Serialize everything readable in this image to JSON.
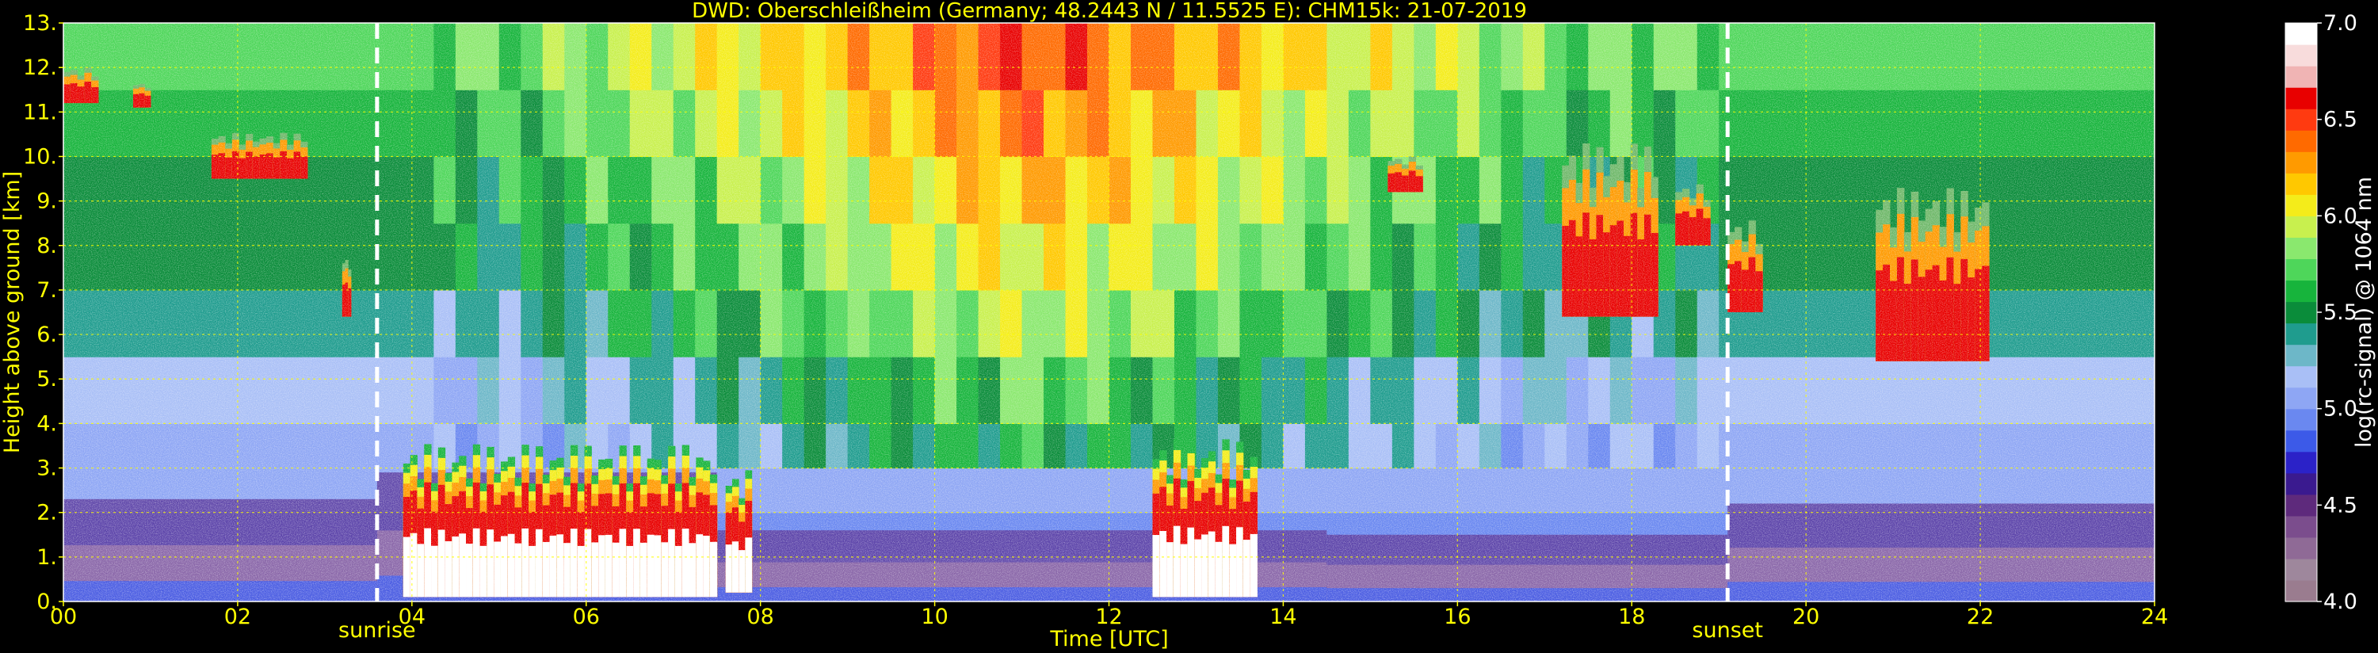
{
  "chart_data": {
    "type": "heatmap",
    "title": "DWD: Oberschleißheim (Germany; 48.2443 N / 11.5525 E):    CHM15k: 21-07-2019",
    "xlabel": "Time [UTC]",
    "ylabel": "Height above ground [km]",
    "xlim": [
      0,
      24
    ],
    "ylim": [
      0,
      13
    ],
    "x_ticks": [
      "00",
      "02",
      "04",
      "06",
      "08",
      "10",
      "12",
      "14",
      "16",
      "18",
      "20",
      "22",
      "24"
    ],
    "y_ticks": [
      "0.",
      "1.",
      "2.",
      "3.",
      "4.",
      "5.",
      "6.",
      "7.",
      "8.",
      "9.",
      "10.",
      "11.",
      "12.",
      "13."
    ],
    "grid": true,
    "colorbar": {
      "label": "log(rc-signal) @ 1064 nm",
      "range": [
        4.0,
        7.0
      ],
      "ticks": [
        "4.0",
        "4.5",
        "5.0",
        "5.5",
        "6.0",
        "6.5",
        "7.0"
      ],
      "colors": [
        "#9a7c8f",
        "#9e879c",
        "#8f6a96",
        "#7b4d8d",
        "#5e2a7c",
        "#3a1a8f",
        "#2b22c8",
        "#3c5ae8",
        "#6a88f0",
        "#8ea6f4",
        "#a9bff6",
        "#6db7c8",
        "#1f9c8e",
        "#0a8c3a",
        "#17b43c",
        "#4ed65a",
        "#8ae86e",
        "#c8f04e",
        "#f4ec1a",
        "#ffc800",
        "#ff9a00",
        "#ff6a00",
        "#ff3a10",
        "#e80000",
        "#f0b4b4",
        "#f8dcdc",
        "#ffffff"
      ]
    },
    "vertical_markers": [
      {
        "label": "sunrise",
        "time": 3.6
      },
      {
        "label": "sunset",
        "time": 19.1
      }
    ],
    "features": {
      "boundary_layer": [
        {
          "t0": 0,
          "t1": 3.6,
          "top": 2.3
        },
        {
          "t0": 3.6,
          "t1": 7.5,
          "top": 2.9
        },
        {
          "t0": 7.5,
          "t1": 14.5,
          "top": 1.6
        },
        {
          "t0": 14.5,
          "t1": 19.1,
          "top": 1.5
        },
        {
          "t0": 19.1,
          "t1": 24,
          "top": 2.2
        }
      ],
      "low_cloud": [
        {
          "t0": 3.9,
          "t1": 7.5,
          "base": 0.1,
          "top": 3.1
        },
        {
          "t0": 7.6,
          "t1": 7.9,
          "base": 0.2,
          "top": 2.6
        },
        {
          "t0": 12.5,
          "t1": 13.7,
          "base": 0.1,
          "top": 3.2
        }
      ],
      "cirrus": [
        {
          "t0": 0.0,
          "t1": 0.4,
          "base": 11.2,
          "top": 11.9
        },
        {
          "t0": 0.8,
          "t1": 1.0,
          "base": 11.1,
          "top": 11.6
        },
        {
          "t0": 1.7,
          "t1": 2.8,
          "base": 9.5,
          "top": 10.4
        },
        {
          "t0": 3.2,
          "t1": 3.3,
          "base": 6.4,
          "top": 7.6
        },
        {
          "t0": 15.2,
          "t1": 15.6,
          "base": 9.2,
          "top": 9.9
        },
        {
          "t0": 17.2,
          "t1": 18.3,
          "base": 6.4,
          "top": 9.8
        },
        {
          "t0": 18.5,
          "t1": 18.9,
          "base": 8.0,
          "top": 9.2
        },
        {
          "t0": 19.1,
          "t1": 19.5,
          "base": 6.5,
          "top": 8.3
        },
        {
          "t0": 20.8,
          "t1": 22.1,
          "base": 5.4,
          "top": 8.8
        }
      ]
    }
  }
}
